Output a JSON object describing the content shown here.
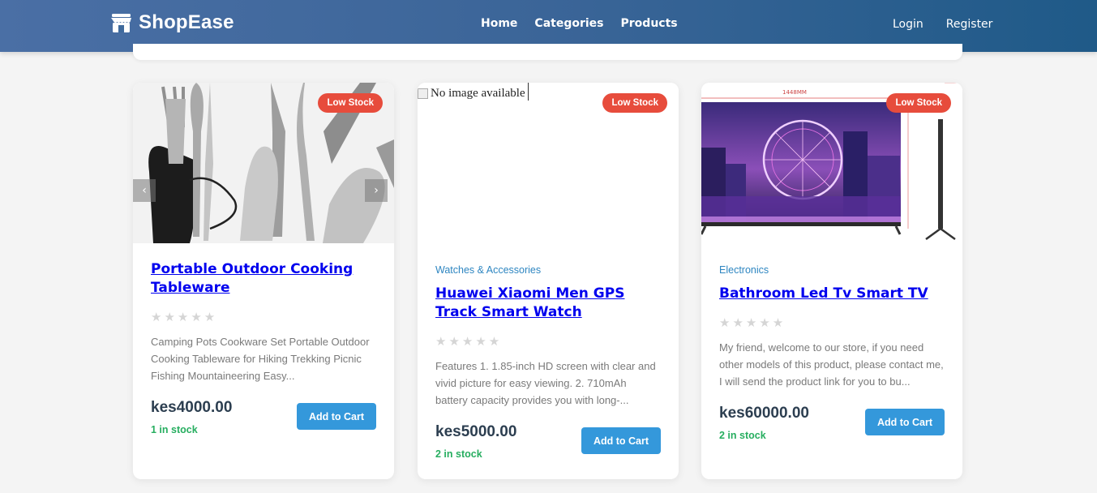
{
  "header": {
    "brand": "ShopEase",
    "nav": [
      "Home",
      "Categories",
      "Products"
    ],
    "auth": {
      "login": "Login",
      "register": "Register"
    }
  },
  "products": [
    {
      "badge": "Low Stock",
      "category": "",
      "title": "Portable Outdoor Cooking Tableware",
      "rating_stars": "★★★★★",
      "rating_value": 0,
      "description": "Camping Pots Cookware Set Portable Outdoor Cooking Tableware for Hiking Trekking Picnic Fishing Mountaineering Easy...",
      "price": "kes4000.00",
      "stock": "1 in stock",
      "cta": "Add to Cart",
      "carousel_prev": "‹",
      "carousel_next": "›"
    },
    {
      "badge": "Low Stock",
      "category": "Watches & Accessories",
      "title": "Huawei Xiaomi Men GPS Track Smart Watch",
      "rating_stars": "★★★★★",
      "rating_value": 0,
      "description": "Features 1. 1.85-inch HD screen with clear and vivid picture for easy viewing. 2. 710mAh battery capacity provides you with long-...",
      "price": "kes5000.00",
      "stock": "2 in stock",
      "cta": "Add to Cart",
      "image_alt": "No image available"
    },
    {
      "badge": "Low Stock",
      "category": "Electronics",
      "title": "Bathroom Led Tv Smart TV",
      "rating_stars": "★★★★★",
      "rating_value": 0,
      "description": "My friend, welcome to our store, if you need other models of this product, please contact me, I will send the product link for you to bu...",
      "price": "kes60000.00",
      "stock": "2 in stock",
      "cta": "Add to Cart",
      "dimension_label": "1448MM"
    }
  ],
  "colors": {
    "header_start": "#4a6fa5",
    "header_end": "#1f5a88",
    "badge": "#e74c3c",
    "button": "#3498db",
    "stock": "#27ae60",
    "category": "#2e86c1",
    "link": "#0000ee"
  }
}
